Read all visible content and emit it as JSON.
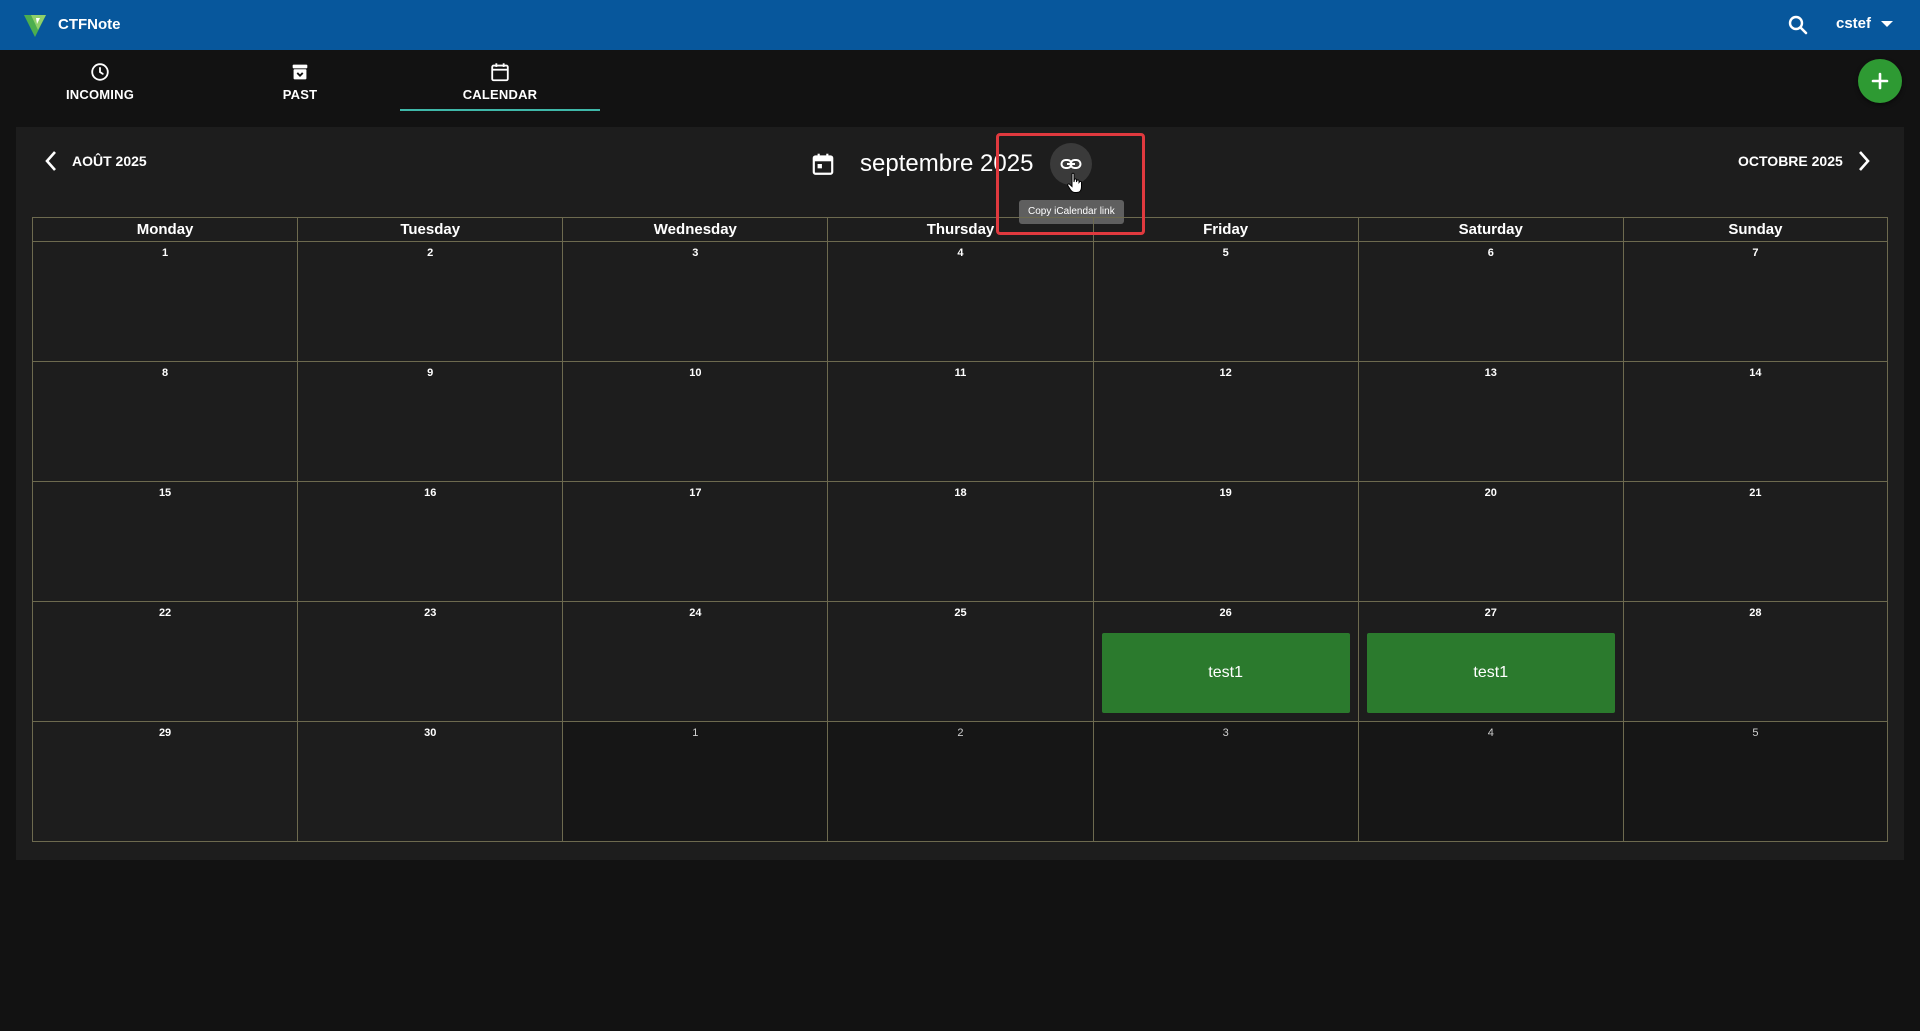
{
  "app": {
    "name": "CTFNote",
    "username": "cstef"
  },
  "tabs": [
    {
      "label": "INCOMING",
      "icon": "clock-icon"
    },
    {
      "label": "PAST",
      "icon": "archive-icon"
    },
    {
      "label": "CALENDAR",
      "icon": "calendar-icon",
      "active": true
    }
  ],
  "calendar": {
    "prev_label": "AOÛT 2025",
    "next_label": "OCTOBRE 2025",
    "title": "septembre 2025",
    "tooltip": "Copy iCalendar link",
    "weekdays": [
      "Monday",
      "Tuesday",
      "Wednesday",
      "Thursday",
      "Friday",
      "Saturday",
      "Sunday"
    ],
    "weeks": [
      [
        "1",
        "2",
        "3",
        "4",
        "5",
        "6",
        "7"
      ],
      [
        "8",
        "9",
        "10",
        "11",
        "12",
        "13",
        "14"
      ],
      [
        "15",
        "16",
        "17",
        "18",
        "19",
        "20",
        "21"
      ],
      [
        "22",
        "23",
        "24",
        "25",
        "26",
        "27",
        "28"
      ],
      [
        "29",
        "30",
        "1",
        "2",
        "3",
        "4",
        "5"
      ]
    ],
    "events": [
      {
        "title": "test1",
        "day": "26"
      },
      {
        "title": "test1",
        "day": "27"
      }
    ]
  },
  "colors": {
    "header": "#07579c",
    "accent": "#3fb8a9",
    "fab": "#2e9a33",
    "event": "#2b7a2d"
  }
}
